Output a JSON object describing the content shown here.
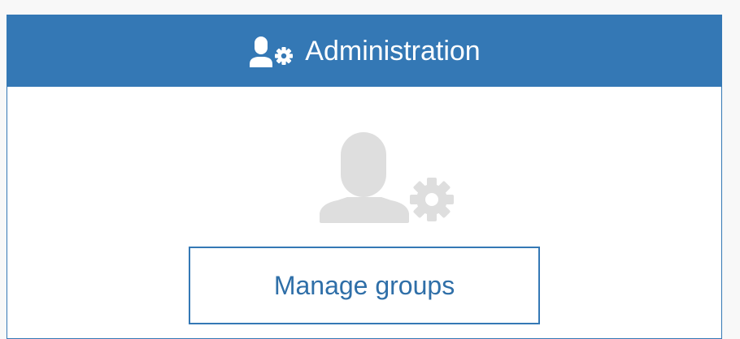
{
  "header": {
    "title": "Administration",
    "icon": "user-gear-icon"
  },
  "main": {
    "illustration_icon": "user-gear-icon",
    "manage_groups_label": "Manage groups"
  },
  "colors": {
    "accent": "#3478b5",
    "icon_gray": "#dedede",
    "button_text": "#2f6fa8"
  }
}
